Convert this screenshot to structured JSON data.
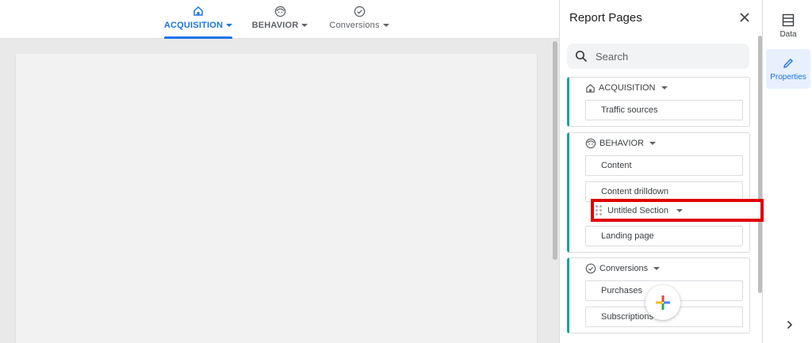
{
  "nav": {
    "tabs": [
      {
        "label": "ACQUISITION",
        "icon": "home-icon"
      },
      {
        "label": "BEHAVIOR",
        "icon": "face-icon"
      },
      {
        "label": "Conversions",
        "icon": "check-circle-icon"
      }
    ],
    "active_tab": "ACQUISITION"
  },
  "panel": {
    "title": "Report Pages",
    "search_placeholder": "Search",
    "sections": [
      {
        "label": "ACQUISITION",
        "icon": "home-icon",
        "pages": [
          "Traffic sources"
        ]
      },
      {
        "label": "BEHAVIOR",
        "icon": "face-icon",
        "pages": [
          "Content",
          "Content drilldown",
          "Landing page"
        ]
      },
      {
        "label": "Conversions",
        "icon": "check-circle-icon",
        "pages": [
          "Purchases",
          "Subscriptions"
        ]
      }
    ],
    "dragging_item": "Untitled Section"
  },
  "rail": {
    "data_label": "Data",
    "properties_label": "Properties"
  },
  "colors": {
    "accent": "#1a73e8",
    "section_border": "#12a4a0",
    "highlight": "#e00000"
  }
}
